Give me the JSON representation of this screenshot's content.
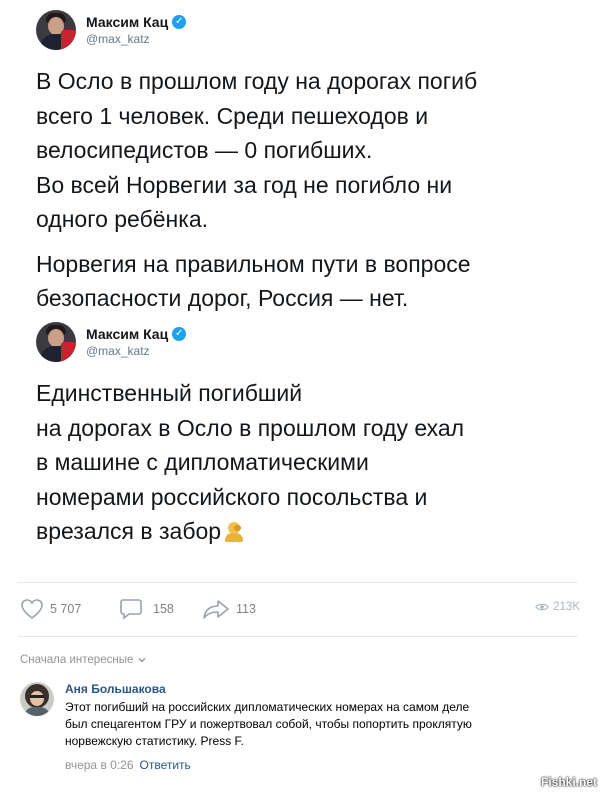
{
  "tweets": [
    {
      "author": "Максим Кац",
      "handle": "@max_katz",
      "paragraphs": [
        [
          "В Осло в прошлом году на дорогах погиб",
          "всего 1 человек. Среди пешеходов и",
          "велосипедистов — 0 погибших.",
          "Во всей Норвегии за год не погибло ни",
          "одного ребёнка."
        ],
        [
          "Норвегия на правильном пути в вопросе",
          "безопасности дорог, Россия — нет."
        ]
      ]
    },
    {
      "author": "Максим Кац",
      "handle": "@max_katz",
      "lines": [
        "Единственный погибший",
        "на дорогах в Осло в прошлом году ехал",
        "в машине с дипломатическими",
        "номерами российского посольства и",
        "врезался в забор"
      ],
      "emoji": "man-facepalming-icon"
    }
  ],
  "actions": {
    "likes": "5 707",
    "comments": "158",
    "shares": "113",
    "views": "213K"
  },
  "comments_sort": "Сначала интересные",
  "comment": {
    "author": "Аня Большакова",
    "lines": [
      "Этот погибший на российских дипломатических номерах на самом деле",
      "был спецагентом ГРУ и пожертвовал собой, чтобы попортить проклятую",
      "норвежскую статистику. Press F."
    ],
    "time": "вчера в 0:26",
    "reply_label": "Ответить"
  },
  "watermark": "Fishki.net",
  "colors": {
    "verified": "#1da1f2",
    "link": "#2a5885",
    "muted": "#939393"
  }
}
